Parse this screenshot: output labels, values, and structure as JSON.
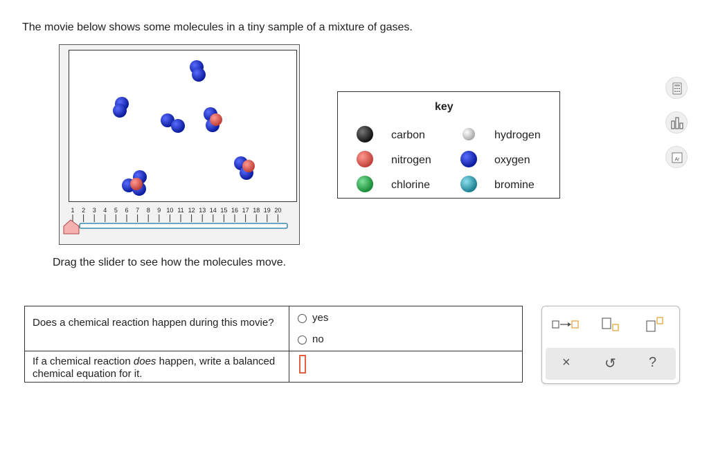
{
  "intro_text": "The movie below shows some molecules in a tiny sample of a mixture of gases.",
  "slider": {
    "ticks": [
      "1",
      "2",
      "3",
      "4",
      "5",
      "6",
      "7",
      "8",
      "9",
      "10",
      "11",
      "12",
      "13",
      "14",
      "15",
      "16",
      "17",
      "18",
      "19",
      "20"
    ],
    "current_frame": 1
  },
  "drag_instruction": "Drag the slider to see how the molecules move.",
  "key": {
    "title": "key",
    "items": [
      {
        "label": "carbon",
        "color": "#333333"
      },
      {
        "label": "hydrogen",
        "color": "#d8d8d8"
      },
      {
        "label": "nitrogen",
        "color": "#e0605a"
      },
      {
        "label": "oxygen",
        "color": "#1c2fc4"
      },
      {
        "label": "chlorine",
        "color": "#2ea84a"
      },
      {
        "label": "bromine",
        "color": "#2aa0b0"
      }
    ]
  },
  "questions": {
    "q1": "Does a chemical reaction happen during this movie?",
    "q1_options": [
      "yes",
      "no"
    ],
    "q2_prefix": "If a chemical reaction ",
    "q2_emphasis": "does",
    "q2_suffix": " happen, write a balanced chemical equation for it."
  },
  "toolbox": {
    "clear_symbol": "×",
    "undo_symbol": "↺",
    "help_symbol": "?"
  },
  "colors": {
    "oxygen": "#1c2fc4",
    "nitrogen": "#e0605a",
    "slider_thumb": "#f5b0b0",
    "input_border": "#e06040"
  }
}
